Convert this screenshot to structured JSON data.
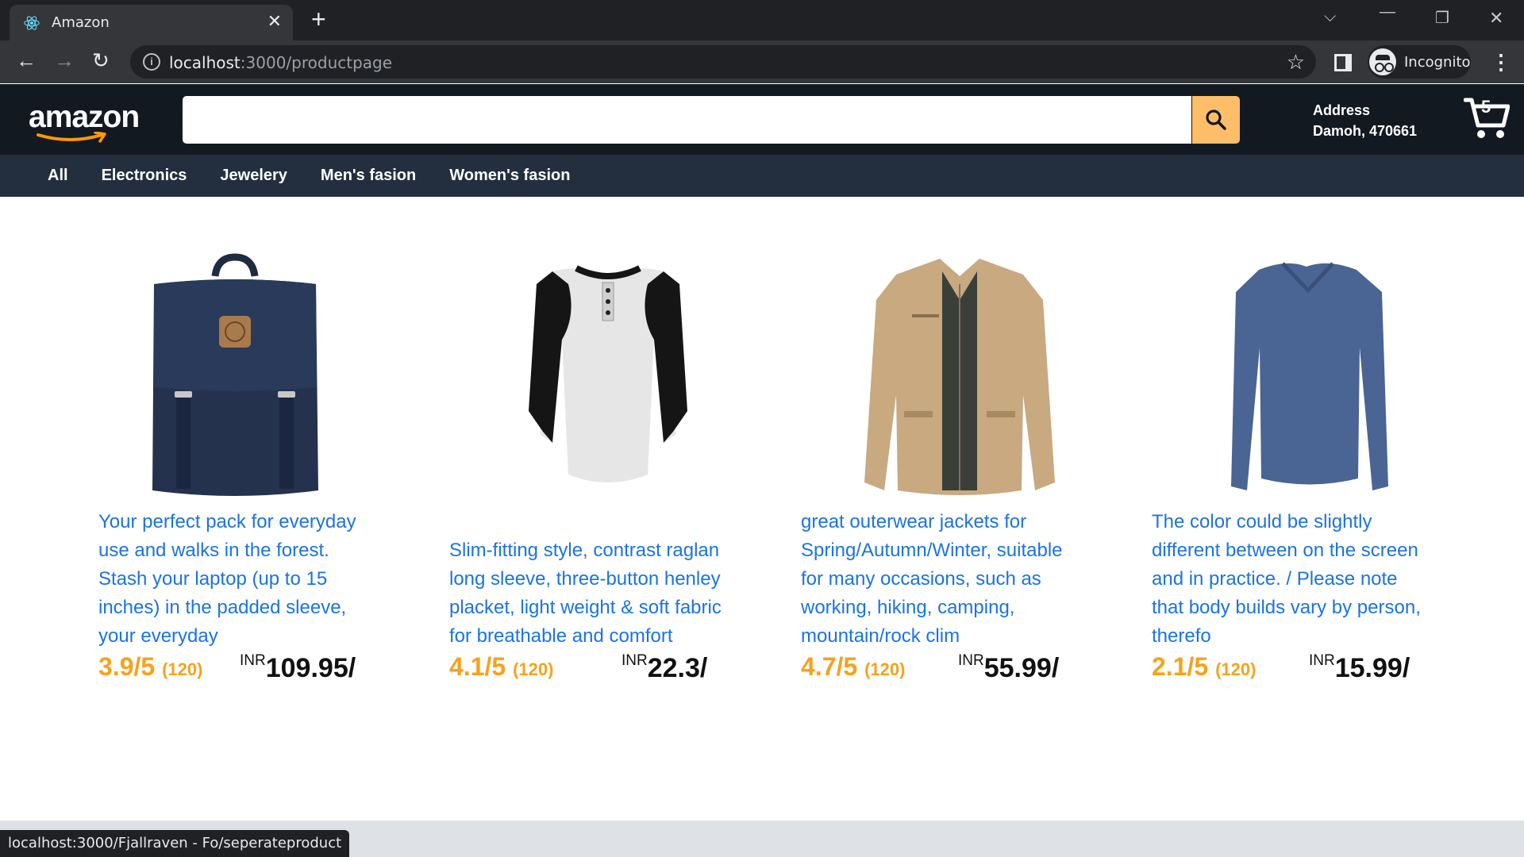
{
  "browser": {
    "tab_title": "Amazon",
    "url_host": "localhost",
    "url_path": ":3000/productpage",
    "profile_label": "Incognito",
    "status_url": "localhost:3000/Fjallraven - Fo/seperateproduct"
  },
  "header": {
    "logo_text": "amazon",
    "search_placeholder": "",
    "address_label": "Address",
    "address_value": "Damoh, 470661",
    "cart_count": "5"
  },
  "subnav": {
    "items": [
      "All",
      "Electronics",
      "Jewelery",
      "Men's fasion",
      "Women's fasion"
    ]
  },
  "products": [
    {
      "image": "navy-backpack",
      "description": "Your perfect pack for everyday use and walks in the forest. Stash your laptop (up to 15 inches) in the padded sleeve, your everyday",
      "rating": "3.9/5",
      "reviews": "(120)",
      "currency": "INR",
      "price": "109.95/"
    },
    {
      "image": "raglan-henley-tshirt",
      "description": "Slim-fitting style, contrast raglan long sleeve, three-button henley placket, light weight & soft fabric for breathable and comfort",
      "rating": "4.1/5",
      "reviews": "(120)",
      "currency": "INR",
      "price": "22.3/"
    },
    {
      "image": "beige-jacket",
      "description": "great outerwear jackets for Spring/Autumn/Winter, suitable for many occasions, such as working, hiking, camping, mountain/rock clim",
      "rating": "4.7/5",
      "reviews": "(120)",
      "currency": "INR",
      "price": "55.99/"
    },
    {
      "image": "blue-long-sleeve",
      "description": "The color could be slightly different between on the screen and in practice. / Please note that body builds vary by person, therefo",
      "rating": "2.1/5",
      "reviews": "(120)",
      "currency": "INR",
      "price": "15.99/"
    }
  ],
  "colors": {
    "header_bg": "#131921",
    "subnav_bg": "#232f3e",
    "search_button": "#febd69",
    "rating": "#f7a21b",
    "description_link": "#1a73e8"
  }
}
